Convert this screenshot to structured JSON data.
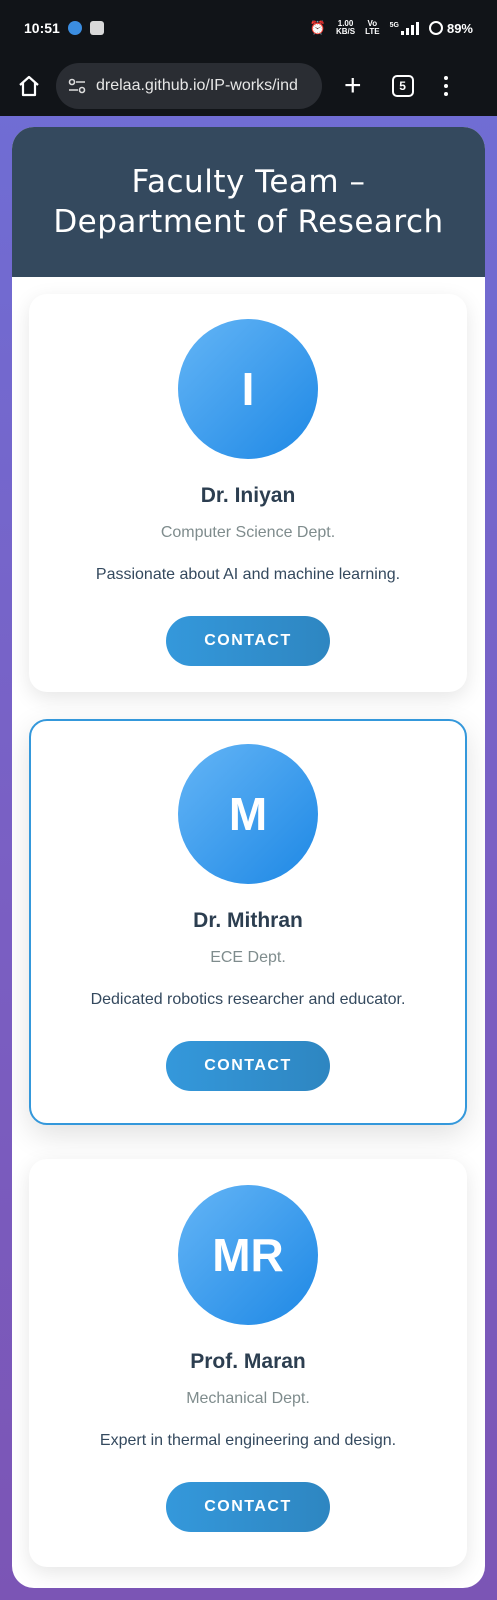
{
  "status_bar": {
    "time": "10:51",
    "net_speed_value": "1.00",
    "net_speed_unit": "KB/S",
    "volte_top": "Vo",
    "volte_bottom": "LTE",
    "signal_label": "5G",
    "battery": "89%"
  },
  "browser": {
    "url": "drelaa.github.io/IP-works/ind",
    "tab_count": "5"
  },
  "page": {
    "title": "Faculty Team – Department of Research"
  },
  "cards": [
    {
      "initials": "I",
      "name": "Dr. Iniyan",
      "dept": "Computer Science Dept.",
      "desc": "Passionate about AI and machine learning.",
      "button": "CONTACT"
    },
    {
      "initials": "M",
      "name": "Dr. Mithran",
      "dept": "ECE Dept.",
      "desc": "Dedicated robotics researcher and educator.",
      "button": "CONTACT"
    },
    {
      "initials": "MR",
      "name": "Prof. Maran",
      "dept": "Mechanical Dept.",
      "desc": "Expert in thermal engineering and design.",
      "button": "CONTACT"
    }
  ],
  "colors": {
    "header_bg": "#34495e",
    "accent": "#3498db",
    "name_text": "#2c3e50",
    "dept_text": "#7f8c8d"
  }
}
